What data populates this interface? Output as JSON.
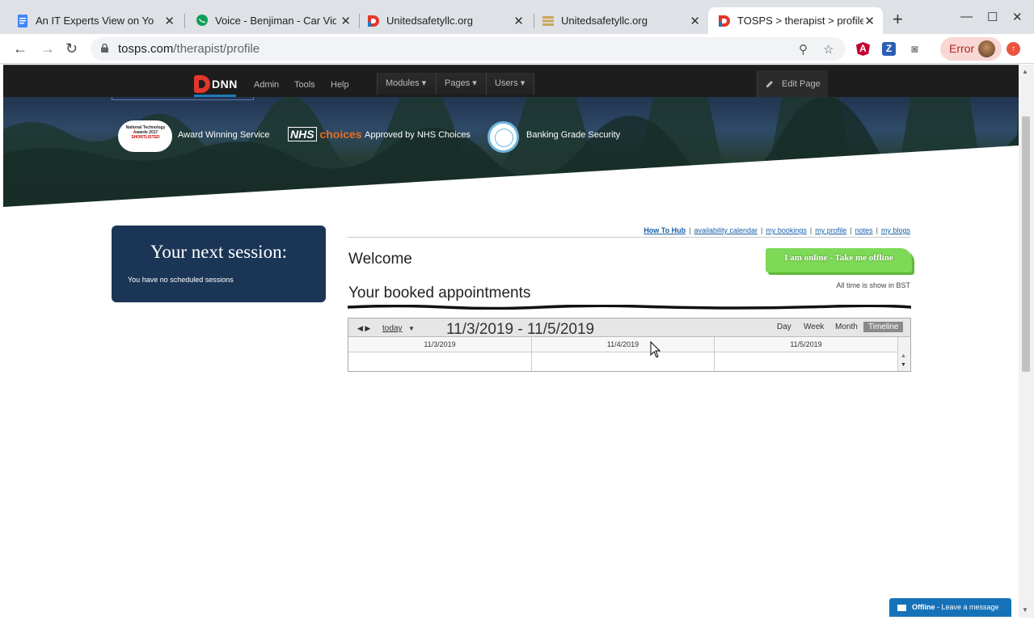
{
  "browser": {
    "tabs": [
      {
        "title": "An IT Experts View on Your",
        "icon": "docs-icon",
        "color": "#4285f4"
      },
      {
        "title": "Voice - Benjiman - Car Vide",
        "icon": "voice-icon",
        "color": "#0f9d58"
      },
      {
        "title": "Unitedsafetyllc.org",
        "icon": "dnn-icon",
        "color": "#e2372c"
      },
      {
        "title": "Unitedsafetyllc.org",
        "icon": "stack-icon",
        "color": "#c9a75d"
      },
      {
        "title": "TOSPS > therapist > profile",
        "icon": "dnn-icon",
        "color": "#e2372c",
        "active": true
      }
    ],
    "url_host": "tosps.com",
    "url_path": "/therapist/profile",
    "error_label": "Error"
  },
  "dnn": {
    "logo": "DNN",
    "links": [
      "Admin",
      "Tools",
      "Help"
    ],
    "menus": [
      "Modules",
      "Pages",
      "Users"
    ],
    "edit_page": "Edit Page"
  },
  "hero": {
    "award_badge": "National Technology Awards 2017 SHORTLISTED",
    "award_text": "Award Winning Service",
    "nhs_logo": "NHS",
    "nhs_choices": "choices",
    "nhs_text": "Approved by NHS Choices",
    "security_text": "Banking Grade Security"
  },
  "session": {
    "title": "Your next session:",
    "note": "You have no scheduled sessions"
  },
  "nav_links": [
    "How To Hub",
    "availability calendar",
    "my bookings",
    "my profile",
    "notes",
    "my blogs"
  ],
  "welcome": "Welcome",
  "online_button": "I am online - Take me offline",
  "bst_note": "All time is show in BST",
  "booked_title": "Your booked appointments",
  "calendar": {
    "today": "today",
    "range": "11/3/2019 - 11/5/2019",
    "views": [
      "Day",
      "Week",
      "Month",
      "Timeline"
    ],
    "active_view": "Timeline",
    "dates": [
      "11/3/2019",
      "11/4/2019",
      "11/5/2019"
    ]
  },
  "chat": {
    "status": "Offline",
    "message": "Leave a message"
  }
}
